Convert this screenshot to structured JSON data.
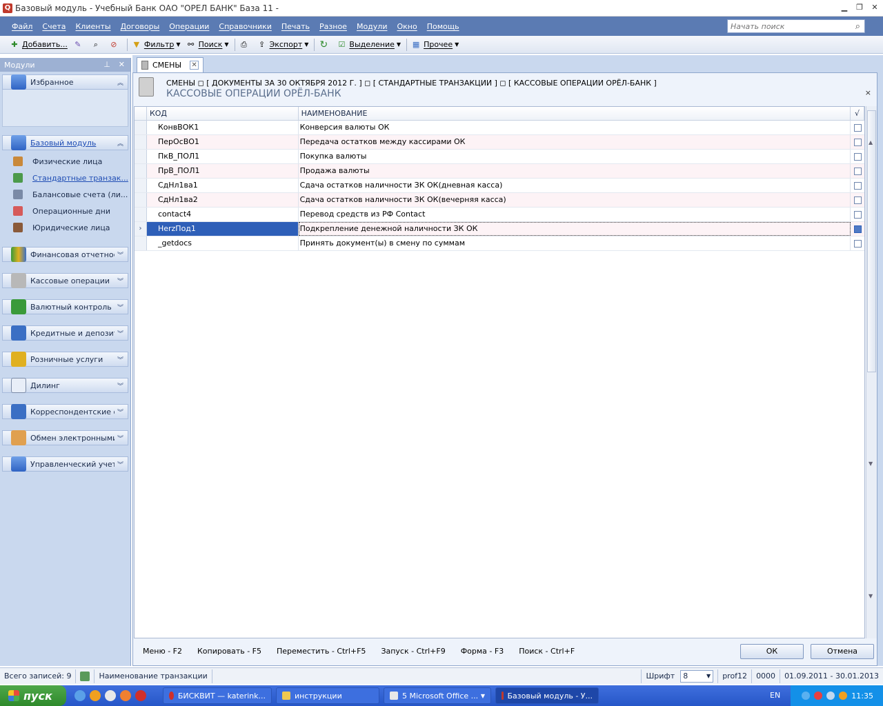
{
  "window": {
    "title": "Базовый модуль - Учебный Банк ОАО \"ОРЕЛ БАНК\" База 11 -"
  },
  "menu": [
    "Файл",
    "Счета",
    "Клиенты",
    "Договоры",
    "Операции",
    "Справочники",
    "Печать",
    "Разное",
    "Модули",
    "Окно",
    "Помощь"
  ],
  "search": {
    "placeholder": "Начать поиск"
  },
  "toolbar": {
    "add": "Добавить...",
    "filter": "Фильтр",
    "search": "Поиск",
    "export": "Экспорт",
    "select": "Выделение",
    "other": "Прочее"
  },
  "sidebar": {
    "header": "Модули",
    "favorites": "Избранное",
    "base_module": "Базовый модуль",
    "items": [
      "Физические лица",
      "Стандартные транзак...",
      "Балансовые счета (ли...",
      "Операционные дни",
      "Юридические лица"
    ],
    "groups": [
      "Финансовая отчетность",
      "Кассовые операции",
      "Валютный контроль",
      "Кредитные и депозитные",
      "Розничные услуги",
      "Дилинг",
      "Корреспондентские отн",
      "Обмен электронными до",
      "Управленческий учет"
    ]
  },
  "tab": {
    "label": "СМЕНЫ"
  },
  "doc": {
    "crumb": "СМЕНЫ  ◻ [ ДОКУМЕНТЫ ЗА 30 ОКТЯБРЯ 2012 Г.  ] ◻ [ СТАНДАРТНЫЕ ТРАНЗАКЦИИ ] ◻ [ КАССОВЫЕ ОПЕРАЦИИ ОРЁЛ-БАНК ]",
    "title": "КАССОВЫЕ ОПЕРАЦИИ ОРЁЛ-БАНК",
    "close": "×"
  },
  "grid": {
    "columns": {
      "code": "КОД",
      "name": "НАИМЕНОВАНИЕ",
      "check": "√"
    },
    "rows": [
      {
        "code": "КонвВОК1",
        "name": "Конверсия валюты ОК"
      },
      {
        "code": "ПерОсВО1",
        "name": "Передача остатков между кассирами ОК"
      },
      {
        "code": "ПкВ_ПОЛ1",
        "name": "Покупка валюты"
      },
      {
        "code": "ПрВ_ПОЛ1",
        "name": "Продажа валюты"
      },
      {
        "code": "СдНл1ва1",
        "name": "Сдача остатков наличности ЗК ОК(дневная касса)"
      },
      {
        "code": "СдНл1ва2",
        "name": "Сдача остатков наличности ЗК ОК(вечерняя касса)"
      },
      {
        "code": "contact4",
        "name": "Перевод средств из РФ Contact"
      },
      {
        "code": "HerzПод1",
        "name": "Подкрепление денежной наличности ЗК ОК"
      },
      {
        "code": "_getdocs",
        "name": "Принять документ(ы) в смену по суммам"
      }
    ],
    "selected_row": 7
  },
  "hotkeys": [
    "Меню - F2",
    "Копировать - F5",
    "Переместить - Ctrl+F5",
    "Запуск - Ctrl+F9",
    "Форма - F3",
    "Поиск - Ctrl+F"
  ],
  "buttons": {
    "ok": "ОК",
    "cancel": "Отмена"
  },
  "status": {
    "records": "Всего записей: 9",
    "field": "Наименование транзакции",
    "font_label": "Шрифт",
    "font_value": "8",
    "user": "prof12",
    "code": "0000",
    "period": "01.09.2011 - 30.01.2013"
  },
  "taskbar": {
    "start": "пуск",
    "tasks": [
      "БИСКВИТ — katerink...",
      "инструкции",
      "5 Microsoft Office ...",
      "Базовый модуль - У..."
    ],
    "lang": "EN",
    "time": "11:35"
  }
}
